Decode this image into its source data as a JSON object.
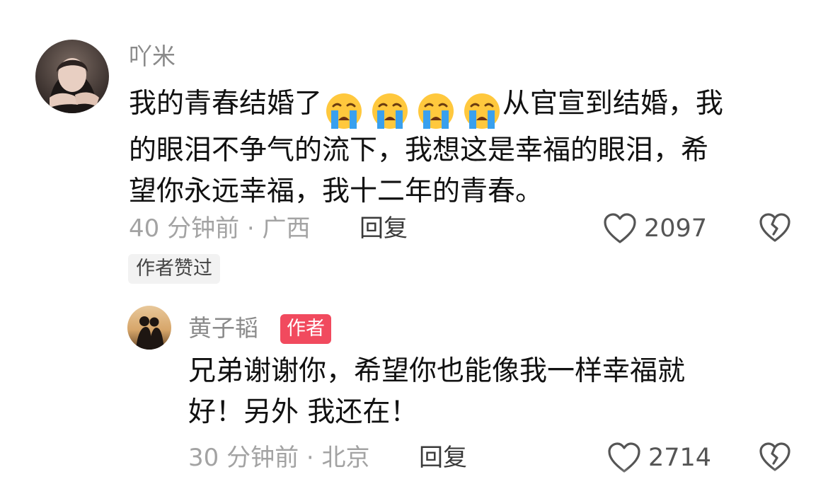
{
  "comments": [
    {
      "username": "吖米",
      "text_lines": [
        "我的青春结婚了",
        "从官宣到结婚，我",
        "的眼泪不争气的流下，我想这是幸福的眼泪，希",
        "望你永远幸福，我十二年的青春。"
      ],
      "emojis": [
        "loudly-crying-face",
        "loudly-crying-face",
        "loudly-crying-face",
        "loudly-crying-face"
      ],
      "time_location": "40 分钟前 · 广西",
      "reply_label": "回复",
      "like_count": "2097",
      "tag": "作者赞过"
    },
    {
      "username": "黄子韬",
      "badge": "作者",
      "text_lines": [
        "兄弟谢谢你，希望你也能像我一样幸福就",
        "好！另外 我还在！"
      ],
      "time_location": "30 分钟前 · 北京",
      "reply_label": "回复",
      "like_count": "2714"
    }
  ],
  "icons": {
    "like": "heart-outline-icon",
    "dislike": "broken-heart-icon",
    "emoji": "loudly-crying-face-emoji"
  },
  "colors": {
    "username": "#8a8a8a",
    "text": "#111111",
    "meta": "#a3a3a3",
    "author_badge": "#f14a5e"
  }
}
